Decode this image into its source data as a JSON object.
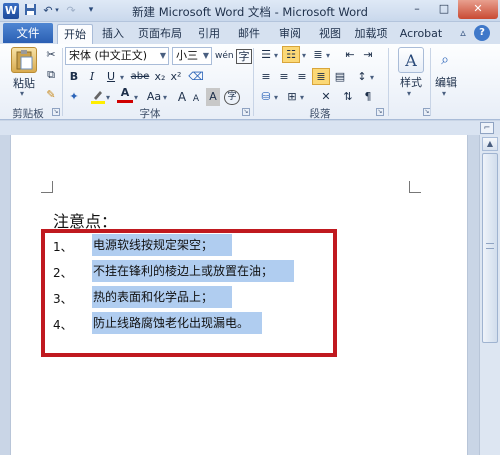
{
  "titlebar": {
    "app_icon_letter": "W",
    "title": "新建 Microsoft Word 文档 - Microsoft Word",
    "minimize": "–",
    "maximize": "□",
    "close": "✕"
  },
  "tabs": {
    "file": "文件",
    "items": [
      "开始",
      "插入",
      "页面布局",
      "引用",
      "邮件",
      "审阅",
      "视图",
      "加载项",
      "Acrobat"
    ]
  },
  "ribbon": {
    "clipboard": {
      "paste_label": "粘贴",
      "group_label": "剪贴板"
    },
    "font": {
      "font_name": "宋体 (中文正文)",
      "font_size": "小三",
      "bold": "B",
      "italic": "I",
      "underline": "U",
      "strike": "abe",
      "subscript": "x₂",
      "superscript": "x²",
      "font_color_glyph": "A",
      "case_glyph": "Aa",
      "grow": "A",
      "shrink": "A",
      "char_shade": "A",
      "enclose": "字",
      "phonetic": "wén",
      "group_label": "字体"
    },
    "paragraph": {
      "group_label": "段落"
    },
    "styles": {
      "label": "样式"
    },
    "editing": {
      "label": "编辑"
    }
  },
  "document": {
    "heading": "注意点：",
    "items": [
      {
        "num": "1、",
        "text": "电源软线按规定架空；"
      },
      {
        "num": "2、",
        "text": "不挂在锋利的棱边上或放置在油；"
      },
      {
        "num": "3、",
        "text": "热的表面和化学品上；"
      },
      {
        "num": "4、",
        "text": "防止线路腐蚀老化出现漏电。"
      }
    ]
  },
  "colors": {
    "highlight": "#b0cdf0",
    "annotation_box": "#c0191f",
    "file_tab": "#2b5fb3"
  }
}
